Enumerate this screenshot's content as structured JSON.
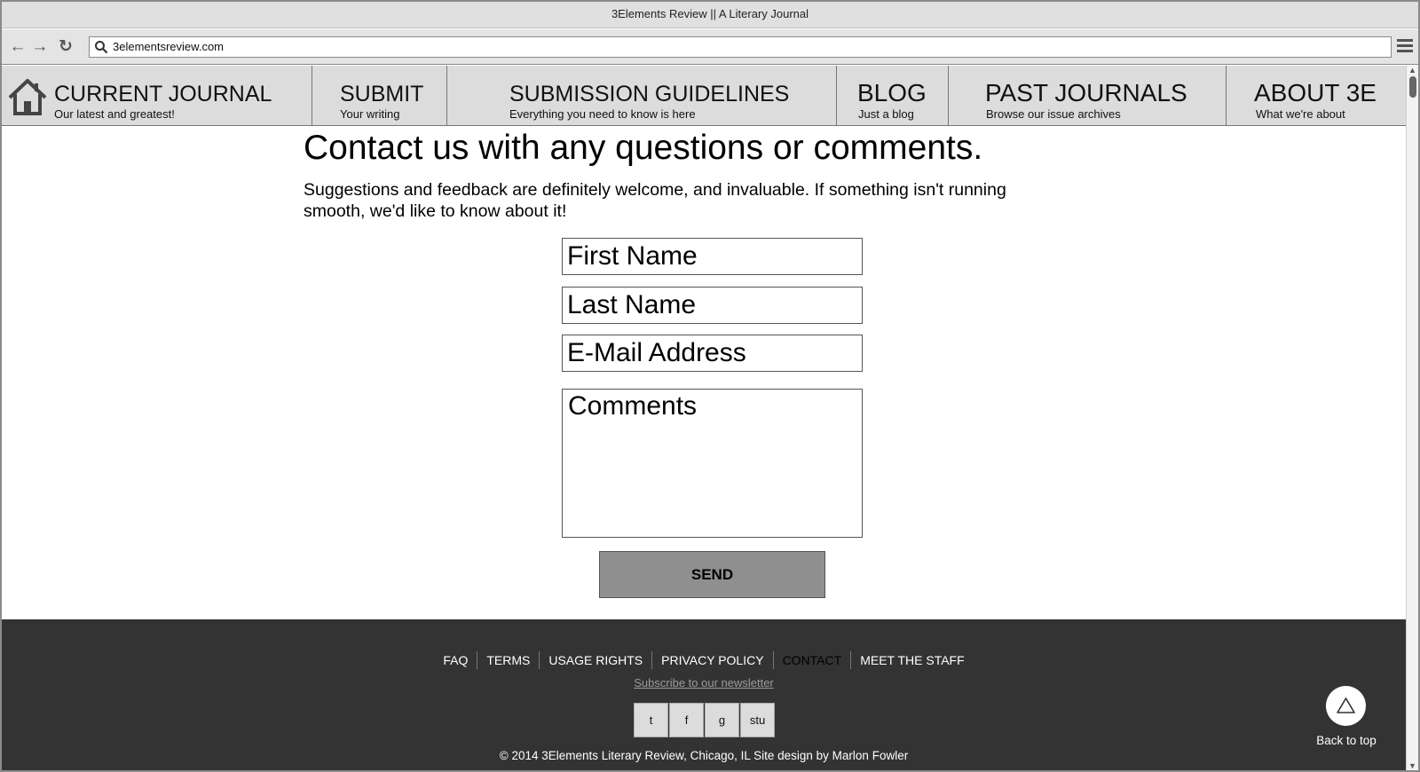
{
  "window": {
    "title": "3Elements Review || A Literary Journal"
  },
  "browser": {
    "url": "3elementsreview.com"
  },
  "nav": {
    "items": [
      {
        "title": "CURRENT JOURNAL",
        "subtitle": "Our latest and greatest!"
      },
      {
        "title": "SUBMIT",
        "subtitle": "Your writing"
      },
      {
        "title": "SUBMISSION GUIDELINES",
        "subtitle": "Everything you need to know is here"
      },
      {
        "title": "BLOG",
        "subtitle": "Just a blog"
      },
      {
        "title": "PAST JOURNALS",
        "subtitle": "Browse our issue archives"
      },
      {
        "title": "ABOUT 3E",
        "subtitle": "What we're about"
      }
    ]
  },
  "main": {
    "heading": "Contact us with any questions or comments.",
    "intro": "Suggestions and feedback are definitely welcome, and invaluable. If something isn't running smooth, we'd like to know about it!"
  },
  "form": {
    "first_name_placeholder": "First Name",
    "last_name_placeholder": "Last Name",
    "email_placeholder": "E-Mail Address",
    "comments_placeholder": "Comments",
    "send_label": "SEND"
  },
  "footer": {
    "links": [
      "FAQ",
      "TERMS",
      "USAGE RIGHTS",
      "PRIVACY POLICY",
      "CONTACT",
      "MEET THE STAFF"
    ],
    "newsletter": "Subscribe to our newsletter",
    "social": [
      "t",
      "f",
      "g",
      "stu"
    ],
    "copyright": "© 2014 3Elements Literary Review, Chicago, IL Site design by Marlon Fowler",
    "back_to_top": "Back to top"
  }
}
